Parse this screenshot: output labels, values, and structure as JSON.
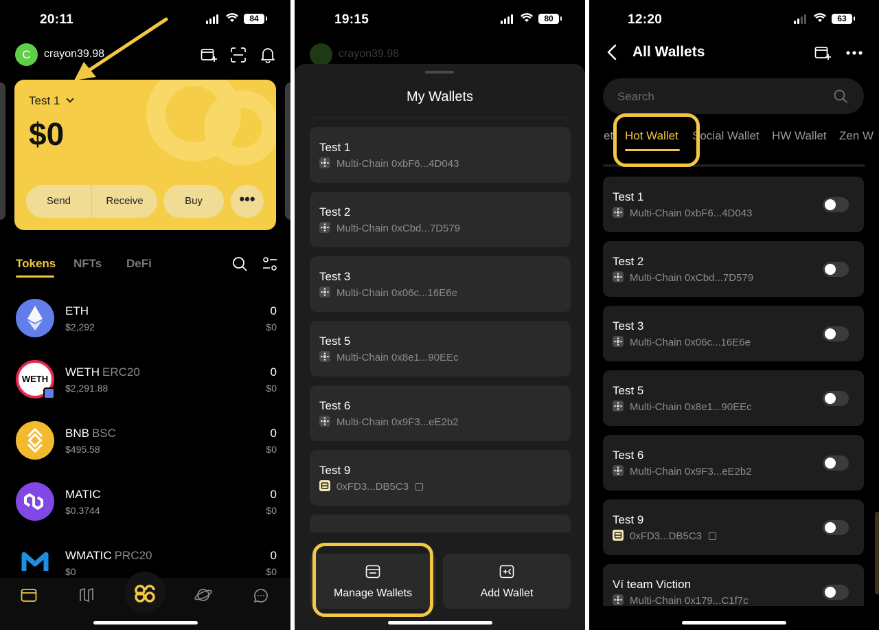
{
  "panel1": {
    "time": "20:11",
    "battery": "84",
    "avatar_letter": "C",
    "username": "crayon39.98",
    "card": {
      "wallet_name": "Test 1",
      "balance": "$0"
    },
    "actions": {
      "send": "Send",
      "receive": "Receive",
      "buy": "Buy"
    },
    "tabs": {
      "tokens": "Tokens",
      "nfts": "NFTs",
      "defi": "DeFi"
    },
    "tokens": [
      {
        "name": "ETH",
        "network": "",
        "price": "$2,292",
        "amount": "0",
        "value": "$0",
        "color": "#627eea"
      },
      {
        "name": "WETH",
        "network": "ERC20",
        "price": "$2,291.88",
        "amount": "0",
        "value": "$0",
        "color": "#ffffff"
      },
      {
        "name": "BNB",
        "network": "BSC",
        "price": "$495.58",
        "amount": "0",
        "value": "$0",
        "color": "#f3ba2f"
      },
      {
        "name": "MATIC",
        "network": "",
        "price": "$0.3744",
        "amount": "0",
        "value": "$0",
        "color": "#8247e5"
      },
      {
        "name": "WMATIC",
        "network": "PRC20",
        "price": "$0",
        "amount": "0",
        "value": "$0",
        "color": "#1e6fd9"
      }
    ],
    "weth_badge": "WETH"
  },
  "panel2": {
    "time": "19:15",
    "battery": "80",
    "dim_username": "crayon39.98",
    "title": "My Wallets",
    "wallets": [
      {
        "name": "Test 1",
        "address": "Multi-Chain 0xbF6...4D043"
      },
      {
        "name": "Test 2",
        "address": "Multi-Chain 0xCbd...7D579"
      },
      {
        "name": "Test 3",
        "address": "Multi-Chain 0x06c...16E6e"
      },
      {
        "name": "Test 5",
        "address": "Multi-Chain 0x8e1...90EEc"
      },
      {
        "name": "Test 6",
        "address": "Multi-Chain 0x9F3...eE2b2"
      },
      {
        "name": "Test 9",
        "address": "0xFD3...DB5C3"
      }
    ],
    "manage_label": "Manage Wallets",
    "add_label": "Add Wallet"
  },
  "panel3": {
    "time": "12:20",
    "battery": "63",
    "title": "All Wallets",
    "search_placeholder": "Search",
    "tabs": {
      "cut": "et",
      "hot": "Hot Wallet",
      "social": "Social Wallet",
      "hw": "HW Wallet",
      "zen": "Zen W"
    },
    "wallets": [
      {
        "name": "Test 1",
        "address": "Multi-Chain 0xbF6...4D043"
      },
      {
        "name": "Test 2",
        "address": "Multi-Chain 0xCbd...7D579"
      },
      {
        "name": "Test 3",
        "address": "Multi-Chain 0x06c...16E6e"
      },
      {
        "name": "Test 5",
        "address": "Multi-Chain 0x8e1...90EEc"
      },
      {
        "name": "Test 6",
        "address": "Multi-Chain 0x9F3...eE2b2"
      },
      {
        "name": "Test 9",
        "address": "0xFD3...DB5C3"
      },
      {
        "name": "Ví team Viction",
        "address": "Multi-Chain 0x179...C1f7c"
      }
    ]
  },
  "colors": {
    "accent": "#f2c744",
    "card": "#f5cd46",
    "background": "#000000"
  }
}
